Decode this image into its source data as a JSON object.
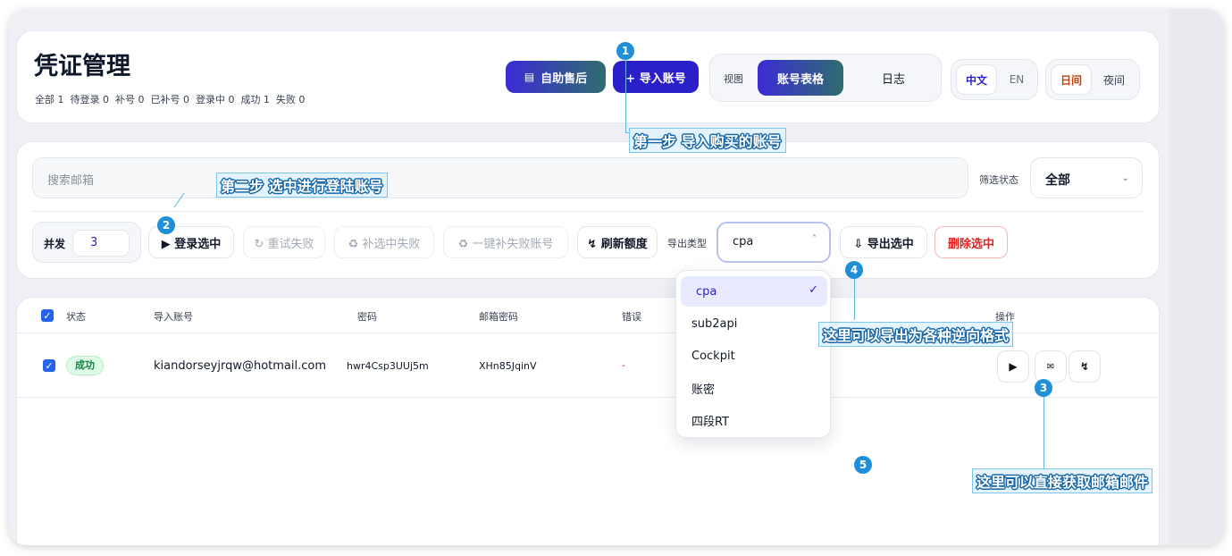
{
  "header": {
    "title": "凭证管理",
    "stats": "全部 1  待登录 0  补号 0  已补号 0  登录中 0  成功 1  失败 0",
    "self_service_label": "自助售后",
    "import_label": "+ 导入账号",
    "view_label": "视图",
    "tab_table_label": "账号表格",
    "tab_log_label": "日志",
    "lang_zh": "中文",
    "lang_en": "EN",
    "theme_day": "日间",
    "theme_night": "夜间"
  },
  "toolbar": {
    "search_placeholder": "搜索邮箱",
    "filter_label": "筛选状态",
    "filter_value": "全部",
    "concurrency_label": "并发",
    "concurrency_value": "3",
    "login_selected": "▶ 登录选中",
    "retry_failed": "↻ 重试失败",
    "refill_selected_failed": "♻ 补选中失败",
    "refill_all_failed": "♻ 一键补失败账号",
    "refresh_quota": "↯ 刷新额度",
    "export_type_label": "导出类型",
    "export_type_value": "cpa",
    "export_selected": "⇩ 导出选中",
    "delete_selected": "删除选中"
  },
  "dropdown": {
    "options": [
      "cpa",
      "sub2api",
      "Cockpit",
      "账密",
      "四段RT"
    ],
    "selected_check": "✓"
  },
  "table": {
    "headers": {
      "status": "状态",
      "account": "导入账号",
      "password": "密码",
      "mail_password": "邮箱密码",
      "error": "错误",
      "actions": "操作"
    },
    "rows": [
      {
        "status": "成功",
        "account": "kiandorseyjrqw@hotmail.com",
        "password": "hwr4Csp3UUj5m",
        "mail_password": "XHn85JqinV",
        "error": "-"
      }
    ]
  },
  "annotations": {
    "step1": "第一步  导入购买的账号",
    "step2": "第二步 选中进行登陆账号",
    "note3": "这里可以直接获取邮箱邮件",
    "note4": "这里可以导出为各种逆向格式",
    "n1": "1",
    "n2": "2",
    "n3": "3",
    "n4": "4",
    "n5": "5"
  },
  "colors": {
    "accent_indigo": "#2b1fc9",
    "accent_green": "#2f6d6e",
    "success_badge_bg": "#dcfce7",
    "danger": "#dc2626",
    "callout": "#1f8fd8"
  }
}
